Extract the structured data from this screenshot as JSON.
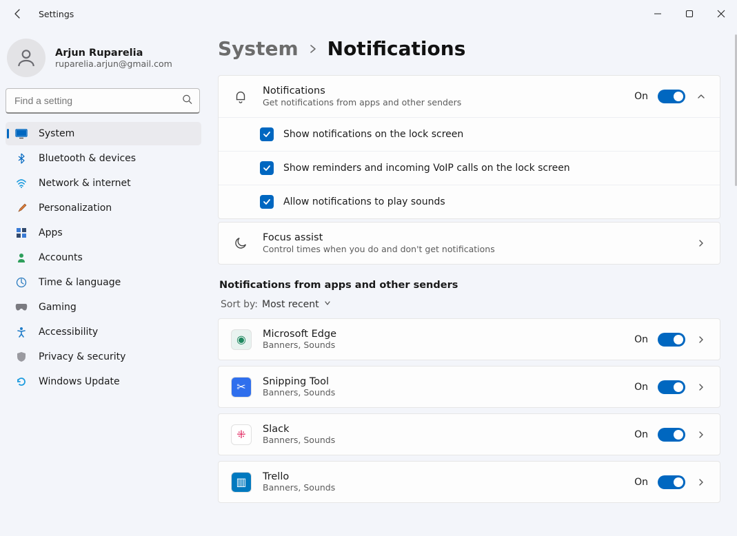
{
  "app_title": "Settings",
  "profile": {
    "name": "Arjun Ruparelia",
    "email": "ruparelia.arjun@gmail.com"
  },
  "search": {
    "placeholder": "Find a setting"
  },
  "nav": [
    {
      "label": "System",
      "active": true
    },
    {
      "label": "Bluetooth & devices"
    },
    {
      "label": "Network & internet"
    },
    {
      "label": "Personalization"
    },
    {
      "label": "Apps"
    },
    {
      "label": "Accounts"
    },
    {
      "label": "Time & language"
    },
    {
      "label": "Gaming"
    },
    {
      "label": "Accessibility"
    },
    {
      "label": "Privacy & security"
    },
    {
      "label": "Windows Update"
    }
  ],
  "breadcrumb": {
    "parent": "System",
    "current": "Notifications"
  },
  "notifications_card": {
    "title": "Notifications",
    "desc": "Get notifications from apps and other senders",
    "state": "On"
  },
  "notif_options": [
    "Show notifications on the lock screen",
    "Show reminders and incoming VoIP calls on the lock screen",
    "Allow notifications to play sounds"
  ],
  "focus": {
    "title": "Focus assist",
    "desc": "Control times when you do and don't get notifications"
  },
  "apps_section_title": "Notifications from apps and other senders",
  "sort": {
    "label": "Sort by:",
    "value": "Most recent"
  },
  "apps": [
    {
      "name": "Microsoft Edge",
      "sub": "Banners, Sounds",
      "state": "On",
      "icon_bg": "#e9f3f0",
      "icon_fg": "#1e885f",
      "glyph": "◉"
    },
    {
      "name": "Snipping Tool",
      "sub": "Banners, Sounds",
      "state": "On",
      "icon_bg": "#2f6fed",
      "icon_fg": "#ffffff",
      "glyph": "✂"
    },
    {
      "name": "Slack",
      "sub": "Banners, Sounds",
      "state": "On",
      "icon_bg": "#ffffff",
      "icon_fg": "#e01e5a",
      "glyph": "⁜"
    },
    {
      "name": "Trello",
      "sub": "Banners, Sounds",
      "state": "On",
      "icon_bg": "#0079bf",
      "icon_fg": "#ffffff",
      "glyph": "▥"
    }
  ]
}
